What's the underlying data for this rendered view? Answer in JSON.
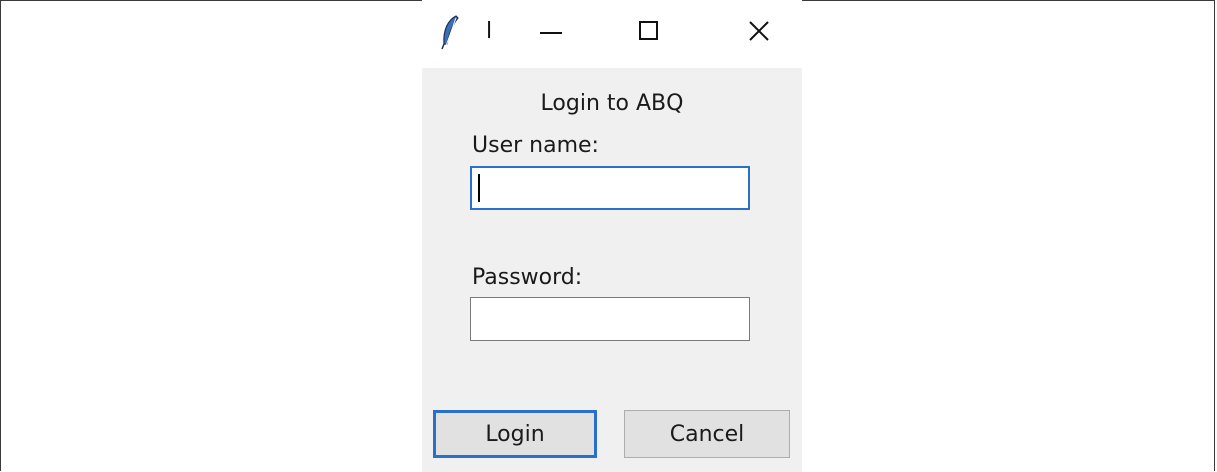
{
  "window": {
    "title": "l",
    "icon": "feather-icon",
    "controls": {
      "minimize_icon": "minimize-icon",
      "maximize_icon": "maximize-icon",
      "close_icon": "close-icon"
    }
  },
  "form": {
    "heading": "Login to ABQ",
    "username_label": "User name:",
    "username_value": "",
    "password_label": "Password:",
    "password_value": ""
  },
  "buttons": {
    "login_label": "Login",
    "cancel_label": "Cancel"
  },
  "colors": {
    "focus_accent": "#2a6fc9",
    "client_background": "#f0f0f0"
  }
}
